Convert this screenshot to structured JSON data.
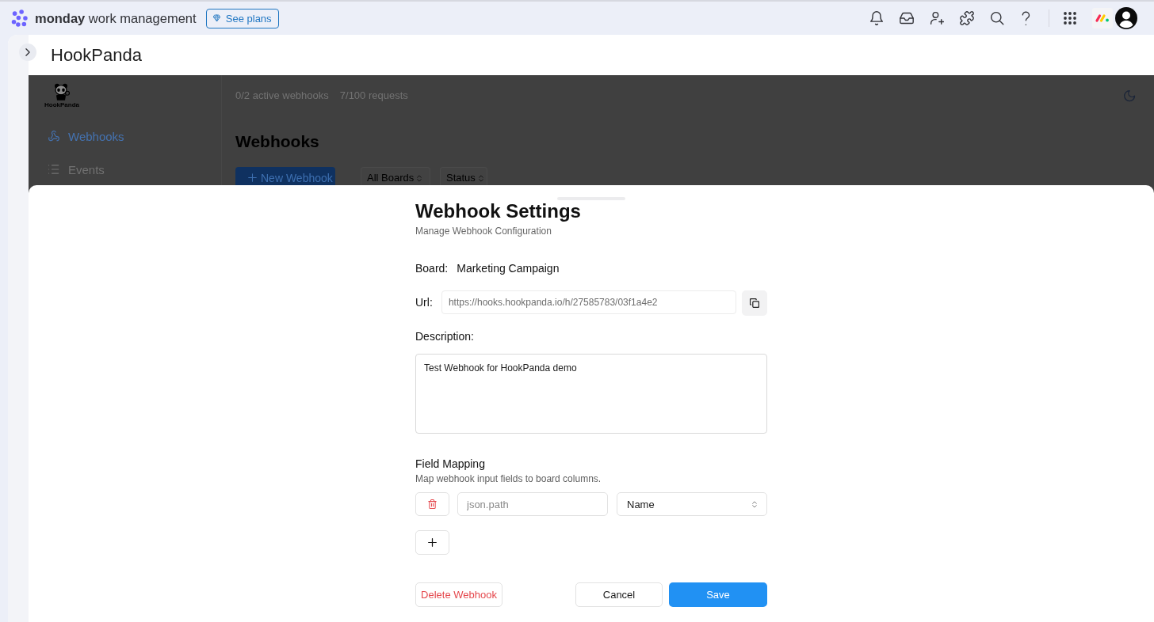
{
  "topbar": {
    "brand": "**monday** work management",
    "plans_button": "See plans"
  },
  "board_header": {
    "title": "HookPanda"
  },
  "app": {
    "logo_caption": "HookPanda",
    "stats": [
      "0/2 active webhooks",
      "7/100 requests"
    ],
    "nav": [
      {
        "label": "Webhooks",
        "selected": true
      },
      {
        "label": "Events",
        "selected": false
      }
    ],
    "heading": "Webhooks",
    "new_button": "New Webhook",
    "filters": [
      "All Boards",
      "Status"
    ]
  },
  "settings_sheet": {
    "title": "Webhook Settings",
    "subtitle": "Manage Webhook Configuration",
    "board": {
      "label": "Board:",
      "value": "Marketing Campaign"
    },
    "url": {
      "label": "Url:",
      "value": "https://hooks.hookpanda.io/h/27585783/03f1a4e2"
    },
    "description": {
      "label": "Description:",
      "value": "Test Webhook for HookPanda demo"
    },
    "field_mapping": {
      "title": "Field Mapping",
      "hint": "Map webhook input fields to board columns.",
      "rows": [
        {
          "placeholder": "json.path",
          "column": "Name"
        }
      ]
    },
    "buttons": {
      "delete": "Delete Webhook",
      "cancel": "Cancel",
      "save": "Save"
    }
  }
}
